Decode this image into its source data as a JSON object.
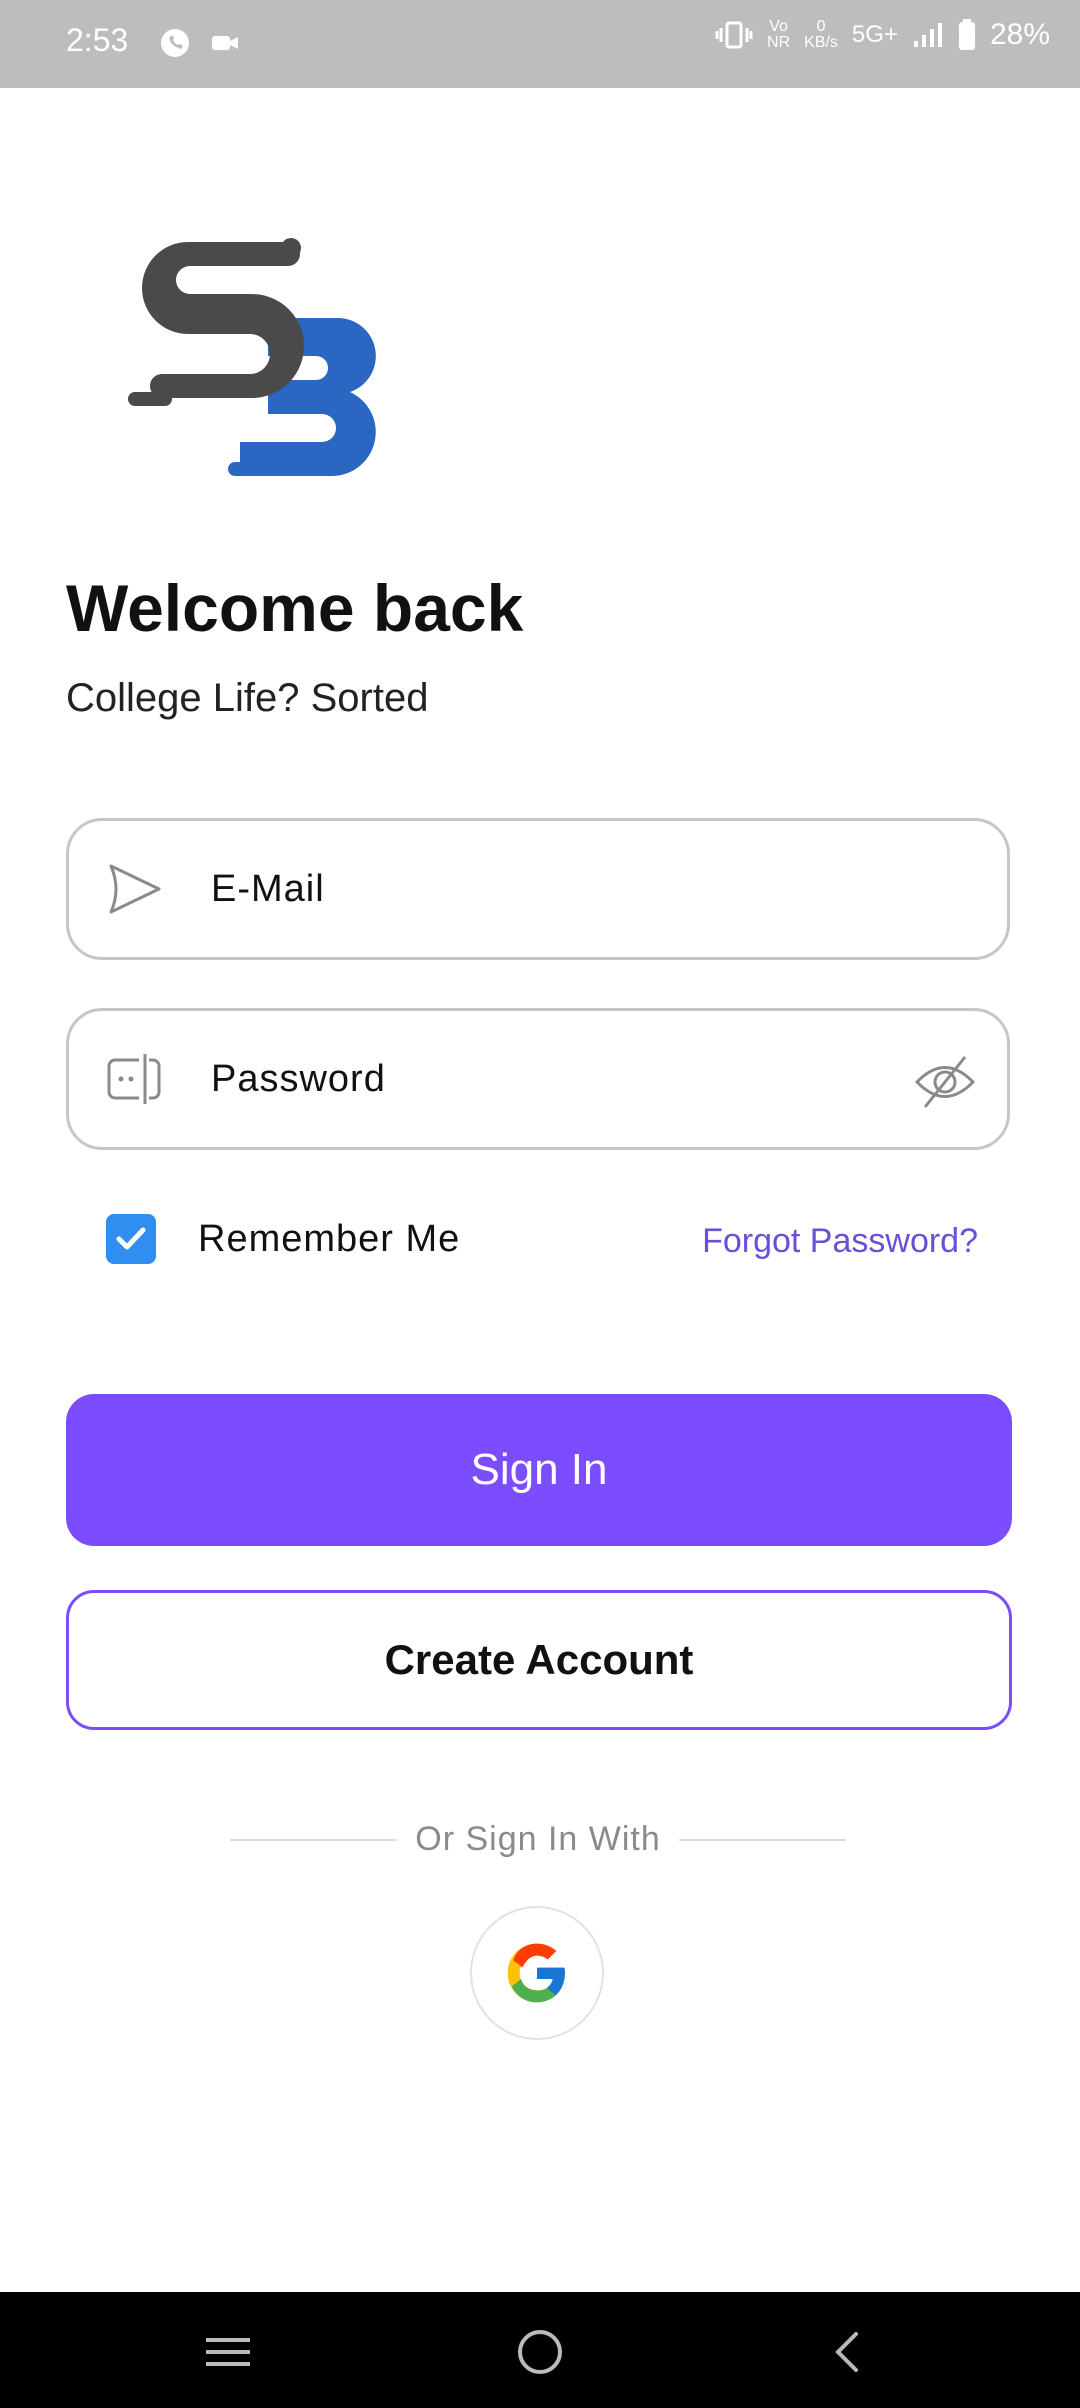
{
  "status": {
    "time": "2:53",
    "network_speed_top": "0",
    "network_speed_unit": "KB/s",
    "network": "5G+",
    "battery": "28%",
    "volte_top": "Vo",
    "volte_bottom": "NR"
  },
  "header": {
    "title": "Welcome back",
    "subtitle": "College Life? Sorted"
  },
  "form": {
    "email_placeholder": "E-Mail",
    "password_placeholder": "Password",
    "remember_label": "Remember Me",
    "remember_checked": true,
    "forgot_label": "Forgot Password?"
  },
  "actions": {
    "sign_in": "Sign In",
    "create_account": "Create Account",
    "or_sign_in_with": "Or Sign In With"
  },
  "colors": {
    "primary": "#7b4dff",
    "checkbox": "#2f8ef0",
    "logo_gray": "#4a4a4a",
    "logo_blue": "#2b66c2"
  }
}
